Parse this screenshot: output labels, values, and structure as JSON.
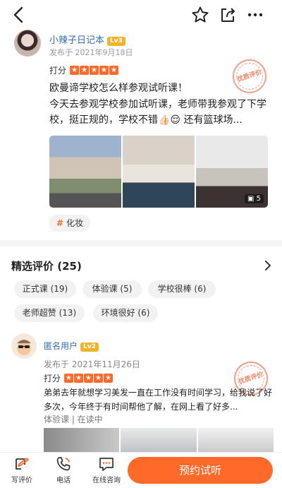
{
  "post": {
    "author": "小辣子日记本",
    "level": "Lv3",
    "date": "发布于 2021年9月18日",
    "rating_label": "打分",
    "stamp": "优质评价",
    "title": "欧曼谛学校怎么样参观试听课！",
    "body": "今天去参观学校参加试听课，老师带我参观了下学校，挺正规的，学校不错👍🏻😌 还有篮球场...",
    "photo_count": "5",
    "tag_hash": "#",
    "tag": "化妆"
  },
  "reviews": {
    "title": "精选评价 (25)",
    "chips": [
      "正式课 (19)",
      "体验课 (5)",
      "学校很棒 (6)",
      "老师超赞 (13)",
      "环境很好 (6)"
    ]
  },
  "review2": {
    "author": "匿名用户",
    "level": "Lv2",
    "date": "发布于 2021年11月26日",
    "rating_label": "打分",
    "stamp": "优质评价",
    "body": "弟弟去年就想学习美发一直在工作没有时间学习，给我说了好多次，今年终于有时间帮他了解，在网上看了好多...",
    "meta": "体验课 | 在读中"
  },
  "bottom_bar": {
    "write": "写评价",
    "phone": "电话",
    "consult": "在线咨询",
    "cta": "预约试听"
  },
  "colors": {
    "accent": "#ff6a2b",
    "link": "#2f6fb0",
    "level": "#f0b32a"
  },
  "icons": [
    "back-icon",
    "star-icon",
    "share-icon",
    "more-icon",
    "chevron-right-icon",
    "write-icon",
    "phone-icon",
    "chat-icon"
  ]
}
